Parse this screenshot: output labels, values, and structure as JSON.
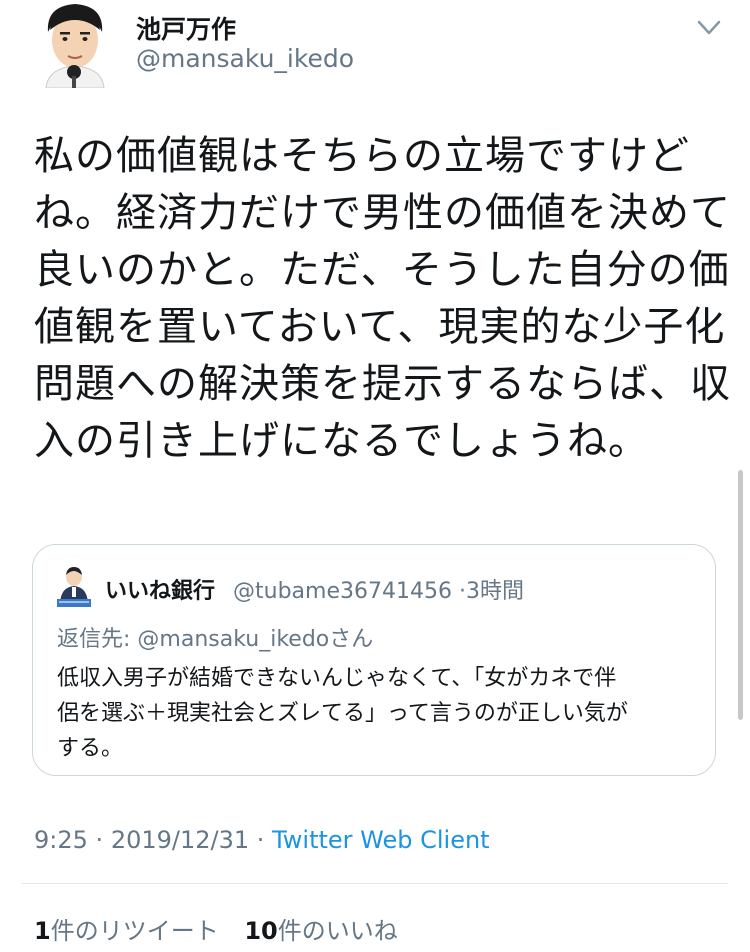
{
  "author": {
    "display_name": "池戸万作",
    "handle": "@mansaku_ikedo",
    "avatar_icon": "man-avatar-icon"
  },
  "tweet": {
    "lines": [
      "私の価値観はそちらの立場ですけど",
      "ね。経済力だけで男性の価値を決めて",
      "良いのかと。ただ、そうした自分の価",
      "値観を置いておいて、現実的な少子化",
      "問題への解決策を提示するならば、収",
      "入の引き上げになるでしょうね。"
    ]
  },
  "quoted_tweet": {
    "display_name": "いいね銀行",
    "handle": "@tubame36741456",
    "separator": "·",
    "time": "3時間",
    "reply_label": "返信先: ",
    "reply_handle": "@mansaku_ikedo",
    "reply_suffix": "さん",
    "lines": [
      "低収入男子が結婚できないんじゃなくて、「女がカネで伴",
      "侶を選ぶ＋現実社会とズレてる」って言うのが正しい気が",
      "する。"
    ]
  },
  "meta": {
    "time": "9:25",
    "sep1": "·",
    "date": "2019/12/31",
    "sep2": "·",
    "client": "Twitter Web Client"
  },
  "stats": {
    "retweets_count": "1",
    "retweets_label": "件のリツイート",
    "likes_count": "10",
    "likes_label": "件のいいね"
  },
  "colors": {
    "text": "#14171a",
    "secondary": "#657786",
    "link": "#1b95e0",
    "border": "#ccd6dd"
  }
}
